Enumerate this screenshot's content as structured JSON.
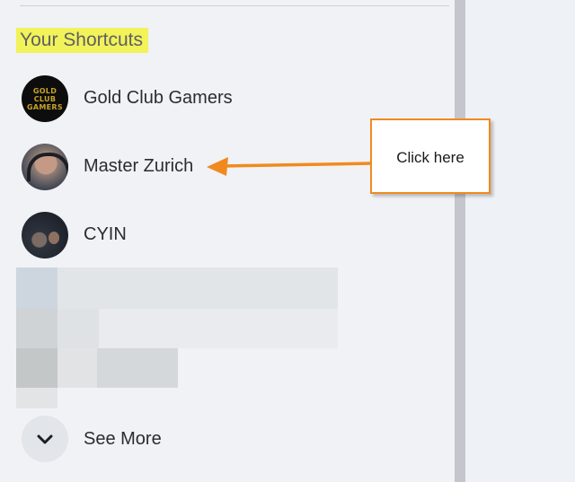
{
  "section_title": "Your Shortcuts",
  "shortcuts": [
    {
      "label": "Gold Club Gamers",
      "avatar_text": [
        "GOLD",
        "CLUB",
        "GAMERS"
      ]
    },
    {
      "label": "Master Zurich"
    },
    {
      "label": "CYIN"
    }
  ],
  "see_more_label": "See More",
  "annotation": {
    "text": "Click here",
    "border_color": "#f08a1e",
    "target": "Master Zurich"
  },
  "colors": {
    "highlight": "#f2f25a",
    "sidebar_bg": "#f0f2f5",
    "scrollbar": "#c4c6cc"
  }
}
